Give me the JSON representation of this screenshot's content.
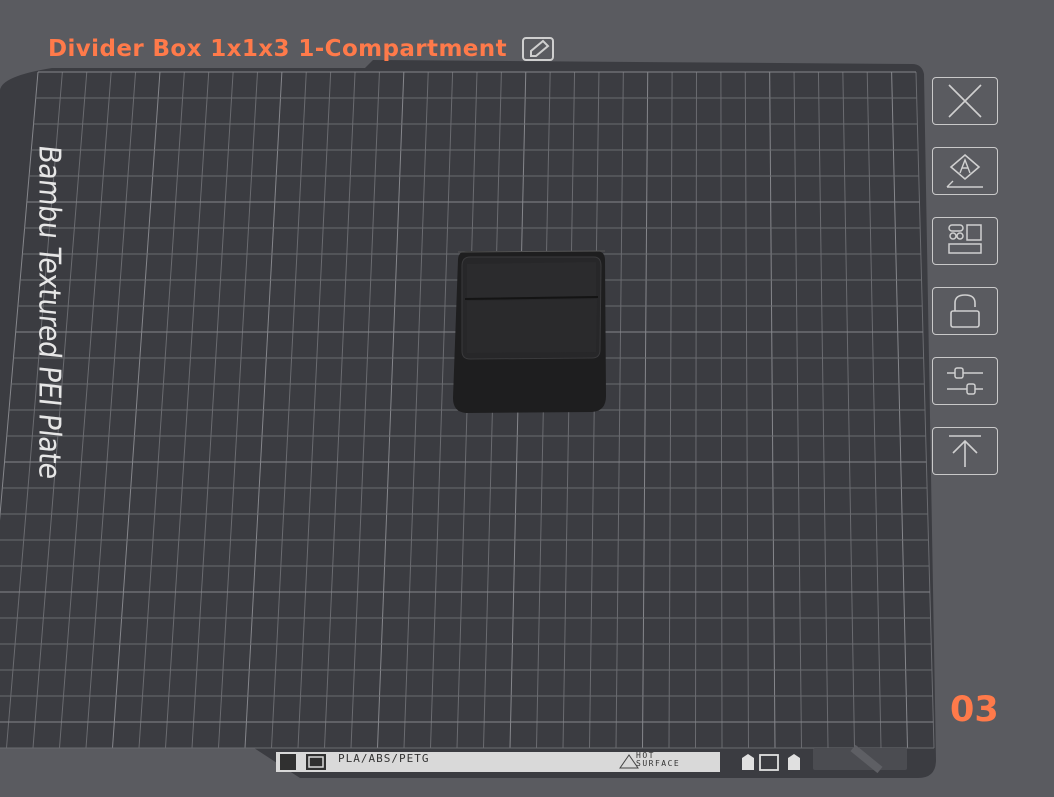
{
  "plate": {
    "title": "Divider Box 1x1x3 1-Compartment",
    "bed_label": "Bambu Textured PEI Plate",
    "number": "03"
  },
  "bed_strip": {
    "materials": "PLA/ABS/PETG",
    "hot_line1": "HOT",
    "hot_line2": "SURFACE"
  },
  "toolbar": {
    "buttons": [
      {
        "name": "close-plate-button",
        "icon": "close-icon"
      },
      {
        "name": "auto-orient-button",
        "icon": "auto-orient-icon"
      },
      {
        "name": "arrange-button",
        "icon": "arrange-icon"
      },
      {
        "name": "lock-button",
        "icon": "lock-icon"
      },
      {
        "name": "plate-settings-button",
        "icon": "sliders-icon"
      },
      {
        "name": "move-to-top-button",
        "icon": "move-top-icon"
      }
    ]
  },
  "colors": {
    "background": "#5a5b60",
    "bed": "#3a3b40",
    "accent": "#ff7a4a",
    "grid": "#6e6f74"
  }
}
